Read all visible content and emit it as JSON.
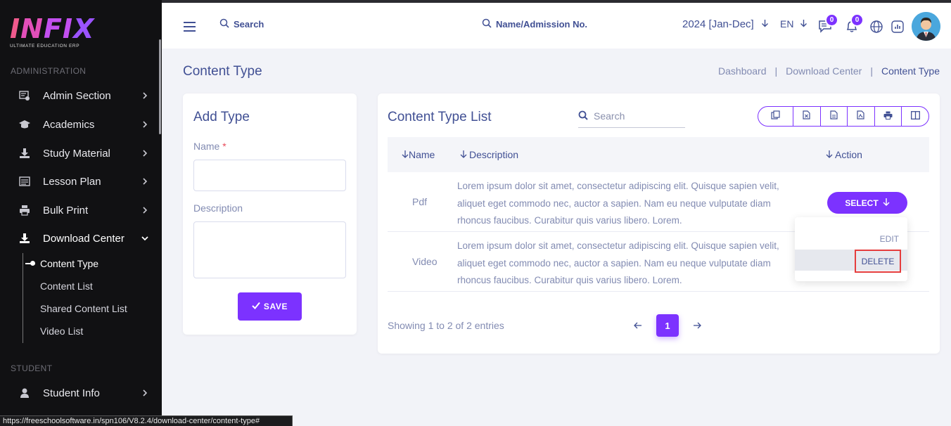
{
  "brand": {
    "name": "INFIX",
    "tagline": "ULTIMATE EDUCATION ERP"
  },
  "sidebar": {
    "section_admin": "ADMINISTRATION",
    "items": [
      {
        "label": "Admin Section",
        "icon": "admin-icon"
      },
      {
        "label": "Academics",
        "icon": "graduation-cap-icon"
      },
      {
        "label": "Study Material",
        "icon": "download-icon"
      },
      {
        "label": "Lesson Plan",
        "icon": "list-icon"
      },
      {
        "label": "Bulk Print",
        "icon": "print-icon"
      },
      {
        "label": "Download Center",
        "icon": "download-icon"
      }
    ],
    "subitems": [
      {
        "label": "Content Type"
      },
      {
        "label": "Content List"
      },
      {
        "label": "Shared Content List"
      },
      {
        "label": "Video List"
      }
    ],
    "section_student": "STUDENT",
    "student_item": {
      "label": "Student Info",
      "icon": "user-icon"
    }
  },
  "topbar": {
    "search_label": "Search",
    "admission_search_label": "Name/Admission No.",
    "year": "2024 [Jan-Dec]",
    "language": "EN",
    "chat_count": "0",
    "notification_count": "0"
  },
  "page": {
    "title": "Content Type",
    "breadcrumb": [
      "Dashboard",
      "Download Center",
      "Content Type"
    ],
    "breadcrumb_sep": "|"
  },
  "add_form": {
    "title": "Add Type",
    "name_label": "Name",
    "required_mark": "*",
    "description_label": "Description",
    "save_label": "SAVE"
  },
  "list": {
    "title": "Content Type List",
    "search_placeholder": "Search",
    "columns": [
      "Name",
      "Description",
      "Action"
    ],
    "rows": [
      {
        "name": "Pdf",
        "description": "Lorem ipsum dolor sit amet, consectetur adipiscing elit. Quisque sapien velit, aliquet eget commodo nec, auctor a sapien. Nam eu neque vulputate diam rhoncus faucibus. Curabitur quis varius libero. Lorem."
      },
      {
        "name": "Video",
        "description": "Lorem ipsum dolor sit amet, consectetur adipiscing elit. Quisque sapien velit, aliquet eget commodo nec, auctor a sapien. Nam eu neque vulputate diam rhoncus faucibus. Curabitur quis varius libero. Lorem."
      }
    ],
    "select_label": "SELECT",
    "dropdown": {
      "edit": "EDIT",
      "delete": "DELETE"
    },
    "showing": "Showing 1 to 2 of 2 entries",
    "current_page": "1"
  },
  "status_url": "https://freeschoolsoftware.in/spn106/V8.2.4/download-center/content-type#",
  "colors": {
    "accent": "#7c32ff",
    "text": "#415094",
    "muted": "#828bb2",
    "sidebar": "#111113"
  }
}
